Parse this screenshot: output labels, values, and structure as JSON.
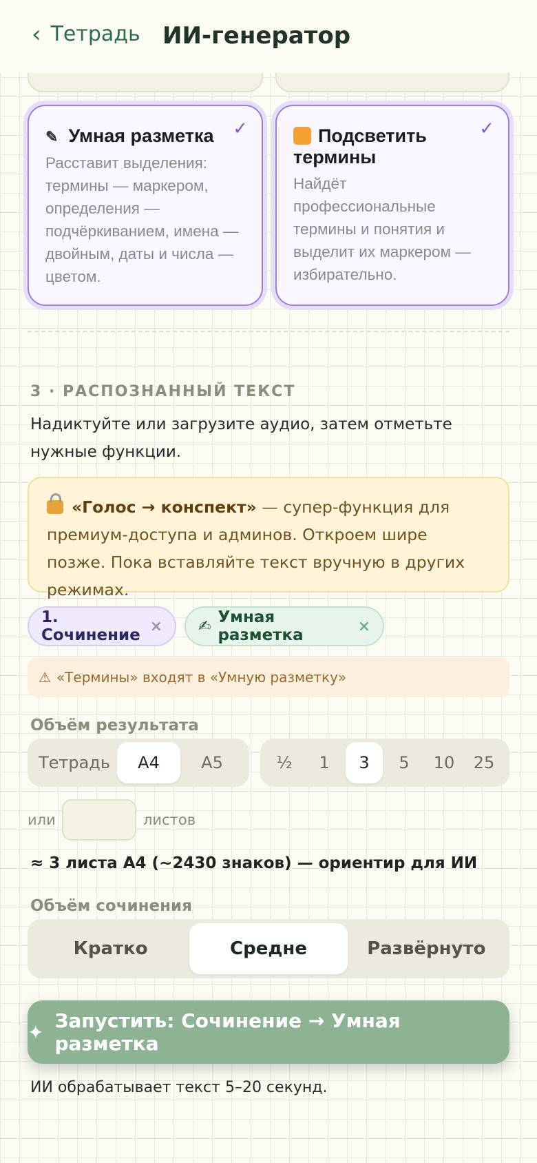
{
  "header": {
    "back_label": "Тетрадь",
    "title": "ИИ-генератор"
  },
  "features": [
    {
      "title": "Умная разметка",
      "icon": "pencil-icon",
      "description": "Расставит выделения: термины — маркером, определения — подчёркиванием, имена — двойным, даты и числа — цветом.",
      "checked": true
    },
    {
      "title": "Подсветить термины",
      "icon": "orange-square-icon",
      "description": "Найдёт профессиональные термины и понятия и выделит их маркером — избирательно.",
      "checked": true
    }
  ],
  "section": {
    "title": "3 · РАСПОЗНАННЫЙ ТЕКСТ",
    "description": "Надиктуйте или загрузите аудио, затем отметьте нужные функции."
  },
  "premium_notice": {
    "bold": "«Голос → конспект»",
    "text": " — супер-функция для премиум-доступа и админов. Откроем шире позже. Пока вставляйте текст вручную в других режимах."
  },
  "chips": [
    {
      "label": "1. Сочинение",
      "remove": "×"
    },
    {
      "label": "Умная разметка",
      "remove": "×"
    }
  ],
  "warning": "«Термины» входят в «Умную разметку»",
  "result_volume": {
    "label": "Объём результата",
    "formats": [
      "Тетрадь",
      "А4",
      "А5"
    ],
    "selected_format": "А4",
    "counts": [
      "½",
      "1",
      "3",
      "5",
      "10",
      "25"
    ],
    "selected_count": "3",
    "or_label": "или",
    "sheets_label": "листов",
    "custom_sheets_value": "",
    "estimate": "≈ 3 листа А4 (~2430 знаков) — ориентир для ИИ"
  },
  "essay_volume": {
    "label": "Объём сочинения",
    "options": [
      "Кратко",
      "Средне",
      "Развёрнуто"
    ],
    "selected": "Средне"
  },
  "run_button": "Запустить: Сочинение → Умная разметка",
  "footer_note": "ИИ обрабатывает текст 5–20 секунд.",
  "colors": {
    "accent_green": "#2f6b4e",
    "card_border_purple": "#9c80d6",
    "run_button": "#8db294",
    "premium_bg": "#fff4d8"
  }
}
